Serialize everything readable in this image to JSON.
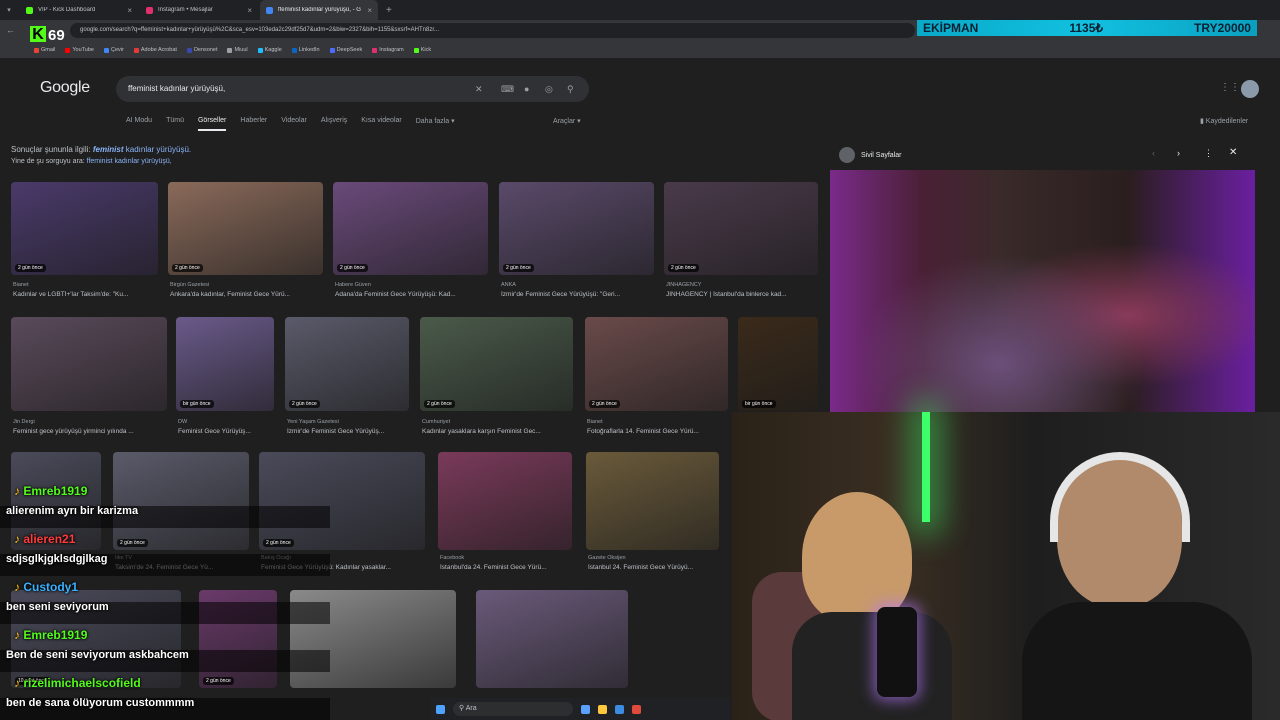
{
  "browser": {
    "tabs": [
      {
        "title": "VIP - Kick Dashboard",
        "color": "#53fc18",
        "active": false
      },
      {
        "title": "Instagram • Mesajlar",
        "color": "#e1306c",
        "active": false
      },
      {
        "title": "ffeminist kadınlar yürüyüşü, - G",
        "color": "#4285f4",
        "active": true
      }
    ],
    "url": "google.com/search?q=ffeminist+kadınlar+yürüyüşü%2C&sca_esv=103eda2c29df25d7&udm=2&biw=2327&bih=1155&sxsrf=AHTn8zr...",
    "bookmarks": [
      "Gmail",
      "YouTube",
      "Çevir",
      "Adobe Acrobat",
      "Densonet",
      "Miuul",
      "Kaggle",
      "LinkedIn",
      "DeepSeek",
      "Instagram",
      "Kick"
    ],
    "bookmark_colors": [
      "#ea4335",
      "#ff0000",
      "#4285f4",
      "#e53935",
      "#3949ab",
      "#9aa0a6",
      "#20beff",
      "#0a66c2",
      "#4d6bfe",
      "#e1306c",
      "#53fc18"
    ]
  },
  "stream": {
    "logo": "69",
    "bar_label": "EKİPMAN",
    "bar_value": "1135₺",
    "bar_goal": "TRY20000"
  },
  "google": {
    "logo": "Google",
    "query": "ffeminist kadınlar yürüyüşü,",
    "nav": [
      "AI Modu",
      "Tümü",
      "Görseller",
      "Haberler",
      "Videolar",
      "Alışveriş",
      "Kısa videolar",
      "Daha fazla ▾"
    ],
    "tools": "Araçlar ▾",
    "saved": "Kaydedilenler",
    "suggest_prefix": "Sonuçlar şununla ilgili:",
    "suggest_bold": "feminist",
    "suggest_rest": "kadınlar yürüyüşü.",
    "suggest2_prefix": "Yine de şu sorguyu ara:",
    "suggest2_link": "ffeminist kadınlar yürüyüşü,"
  },
  "results_row1": [
    {
      "badge": "2 gün önce",
      "source": "Bianet",
      "caption": "Kadınlar ve LGBTİ+'lar Taksim'de: \"Ku...",
      "color": "#4a3a6a"
    },
    {
      "badge": "2 gün önce",
      "source": "Birgün Gazetesi",
      "caption": "Ankara'da kadınlar, Feminist Gece Yürü...",
      "color": "#8a6a5a"
    },
    {
      "badge": "2 gün önce",
      "source": "Habere Güven",
      "caption": "Adana'da Feminist Gece Yürüyüşü: Kad...",
      "color": "#6a4a7a"
    },
    {
      "badge": "2 gün önce",
      "source": "ANKA",
      "caption": "İzmir'de Feminist Gece Yürüyüşü: \"Geri...",
      "color": "#5a4a6a"
    },
    {
      "badge": "2 gün önce",
      "source": "JINHAGENCY",
      "caption": "JINHAGENCY | İstanbul'da binlerce kad...",
      "color": "#4a3a4a"
    }
  ],
  "results_row2": [
    {
      "badge": "",
      "source": "Jin Dergi",
      "caption": "Feminist gece yürüyüşü yirminci yılında ...",
      "color": "#5a4a5a"
    },
    {
      "badge": "bir gün önce",
      "source": "DW",
      "caption": "Feminist Gece Yürüyüş...",
      "color": "#6a5a8a"
    },
    {
      "badge": "2 gün önce",
      "source": "Yeni Yaşam Gazetesi",
      "caption": "İzmir'de Feminist Gece Yürüyüş...",
      "color": "#5a5a6a"
    },
    {
      "badge": "2 gün önce",
      "source": "Cumhuriyet",
      "caption": "Kadınlar yasaklara karşın Feminist Gec...",
      "color": "#4a5a4a"
    },
    {
      "badge": "2 gün önce",
      "source": "Bianet",
      "caption": "Fotoğraflarla 14. Feminist Gece Yürü...",
      "color": "#6a4a4a"
    },
    {
      "badge": "bir gün önce",
      "source": "",
      "caption": "",
      "color": "#3a2a1a"
    }
  ],
  "results_row3": [
    {
      "badge": "",
      "source": "",
      "caption": "",
      "color": "#4a4a5a"
    },
    {
      "badge": "2 gün önce",
      "source": "Ilke TV",
      "caption": "Taksim'de 24. Feminist Gece Yü...",
      "color": "#5a5a6a"
    },
    {
      "badge": "2 gün önce",
      "source": "Bakış Ocağı",
      "caption": "Feminist Gece Yürüyüşü: Kadınlar yasaklar...",
      "color": "#4a4a5a"
    },
    {
      "badge": "",
      "source": "Facebook",
      "caption": "İstanbul'da 24. Feminist Gece Yürü...",
      "color": "#7a3a5a"
    },
    {
      "badge": "",
      "source": "Gazete Oksijen",
      "caption": "İstanbul 24. Feminist Gece Yürüyü...",
      "color": "#6a5a3a"
    }
  ],
  "results_row4": [
    {
      "badge": "10 saat önce",
      "color": "#4a4a5a"
    },
    {
      "badge": "2 gün önce",
      "color": "#6a3a6a"
    },
    {
      "badge": "",
      "color": "#8a8a8a"
    },
    {
      "badge": "",
      "color": "#6a5a7a"
    }
  ],
  "preview": {
    "site": "Sivil Sayfalar"
  },
  "chat": [
    {
      "user": "Emreb1919",
      "color": "#53fc18",
      "msg": "alierenim ayrı bir karizma"
    },
    {
      "user": "alieren21",
      "color": "#ff3b3b",
      "msg": "sdjsglkjgklsdgjlkag"
    },
    {
      "user": "Custody1",
      "color": "#3ab0ff",
      "msg": "ben seni seviyorum"
    },
    {
      "user": "Emreb1919",
      "color": "#53fc18",
      "msg": "Ben de seni seviyorum askbahcem"
    },
    {
      "user": "rizelimichaelscofield",
      "color": "#53fc18",
      "msg": "ben de sana ölüyorum custommmm"
    }
  ],
  "taskbar": {
    "search": "Ara"
  }
}
